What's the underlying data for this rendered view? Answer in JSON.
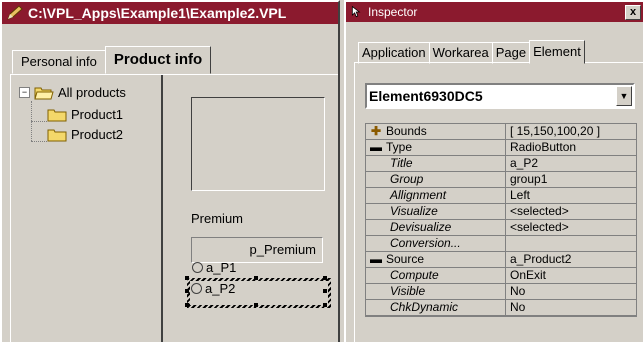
{
  "left_window": {
    "title": "C:\\VPL_Apps\\Example1\\Example2.VPL",
    "tabs": [
      "Personal info",
      "Product info"
    ],
    "active_tab": 1,
    "tree": {
      "root": "All products",
      "children": [
        "Product1",
        "Product2"
      ]
    },
    "premium_label": "Premium",
    "premium_field_value": "p_Premium",
    "radio_1": "a_P1",
    "radio_2": "a_P2"
  },
  "inspector": {
    "title": "Inspector",
    "close_label": "x",
    "tabs": [
      "Application",
      "Workarea",
      "Page",
      "Element"
    ],
    "active_tab": 3,
    "element_select": "Element6930DC5",
    "properties": [
      {
        "name": "Bounds",
        "value": "[ 15,150,100,20 ]",
        "kind": "collapsed"
      },
      {
        "name": "Type",
        "value": "RadioButton",
        "kind": "expanded"
      },
      {
        "name": "Title",
        "value": "a_P2",
        "kind": "child"
      },
      {
        "name": "Group",
        "value": "group1",
        "kind": "child"
      },
      {
        "name": "Allignment",
        "value": "Left",
        "kind": "child"
      },
      {
        "name": "Visualize",
        "value": "<selected>",
        "kind": "child"
      },
      {
        "name": "Devisualize",
        "value": "<selected>",
        "kind": "child"
      },
      {
        "name": "Conversion...",
        "value": "",
        "kind": "child"
      },
      {
        "name": "Source",
        "value": "a_Product2",
        "kind": "expanded"
      },
      {
        "name": "Compute",
        "value": "OnExit",
        "kind": "child"
      },
      {
        "name": "Visible",
        "value": "No",
        "kind": "child"
      },
      {
        "name": "ChkDynamic",
        "value": "No",
        "kind": "child"
      }
    ]
  },
  "colors": {
    "titlebar": "#8b1a2e",
    "face": "#d4d0c8"
  }
}
